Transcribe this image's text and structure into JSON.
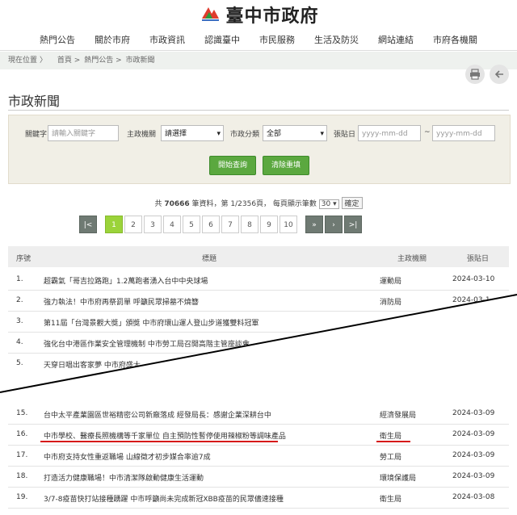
{
  "site": {
    "logo_text": "臺中市政府",
    "logo_sub": "Taichung City Government"
  },
  "nav": [
    "熱門公告",
    "關於市府",
    "市政資訊",
    "認識臺中",
    "市民服務",
    "生活及防災",
    "網站連結",
    "市府各機關"
  ],
  "breadcrumb": {
    "label": "現在位置",
    "items": [
      "首頁",
      "熱門公告",
      "市政新聞"
    ]
  },
  "page_title": "市政新聞",
  "search": {
    "keyword_label": "關鍵字",
    "keyword_placeholder": "請輸入關鍵字",
    "agency_label": "主政機關",
    "agency_value": "請選擇",
    "category_label": "市政分類",
    "category_value": "全部",
    "date_label": "張貼日",
    "date_from_placeholder": "yyyy-mm-dd",
    "date_sep": "~",
    "date_to_placeholder": "yyyy-mm-dd",
    "query_button": "開始查詢",
    "reset_button": "清除重填"
  },
  "results": {
    "prefix": "共",
    "total": "70666",
    "suffix": "筆資料，第 1/2356頁， 每頁顯示筆數",
    "per_page": "30",
    "confirm": "確定"
  },
  "pager": {
    "pages": [
      "1",
      "2",
      "3",
      "4",
      "5",
      "6",
      "7",
      "8",
      "9",
      "10"
    ]
  },
  "table": {
    "headers": [
      "序號",
      "標題",
      "主政機關",
      "張貼日"
    ],
    "rows_top": [
      {
        "no": "1.",
        "title": "超霸氣「哥吉拉路跑」1.2萬跑者湧入台中中央球場",
        "dept": "運動局",
        "date": "2024-03-10"
      },
      {
        "no": "2.",
        "title": "強力執法！中市府再祭罰單 呼籲民眾掃墓不燒簪",
        "dept": "消防局",
        "date": "2024-03-1"
      },
      {
        "no": "3.",
        "title": "第11屆「台灣景觀大獎」頒獎 中市府環山運人登山步道獲雙料冠軍",
        "dept": "",
        "date": ""
      },
      {
        "no": "4.",
        "title": "強化台中港區作業安全管理機制 中市勞工局召開高階主管座談會",
        "dept": "",
        "date": ""
      },
      {
        "no": "5.",
        "title": "天穿日唱出客家夢 中市府盛大",
        "dept": "",
        "date": ""
      }
    ],
    "rows_bottom": [
      {
        "no": "15.",
        "title": "台中太平產業園區世裕精密公司新廠落成 經發局長：感謝企業深耕台中",
        "dept": "經濟發展局",
        "date": "2024-03-09"
      },
      {
        "no": "16.",
        "title": "中市學校、醫療長照機構等千家單位 自主預防性暫停使用辣椒粉等調味產品",
        "dept": "衛生局",
        "date": "2024-03-09"
      },
      {
        "no": "17.",
        "title": "中市府支持女性重返職場 山線徵才初步媒合率逾7成",
        "dept": "勞工局",
        "date": "2024-03-09"
      },
      {
        "no": "18.",
        "title": "打造活力健康職場！中市清潔隊啟動健康生活運動",
        "dept": "環境保護局",
        "date": "2024-03-09"
      },
      {
        "no": "19.",
        "title": "3/7-8疫苗快打站接種踴躍 中市呼籲尚未完成新冠XBB疫苗的民眾儘速接種",
        "dept": "衛生局",
        "date": "2024-03-08"
      }
    ]
  },
  "colors": {
    "accent_green": "#9bd33a",
    "button_green": "#5ba83f",
    "highlight_red": "#d61a1a"
  }
}
